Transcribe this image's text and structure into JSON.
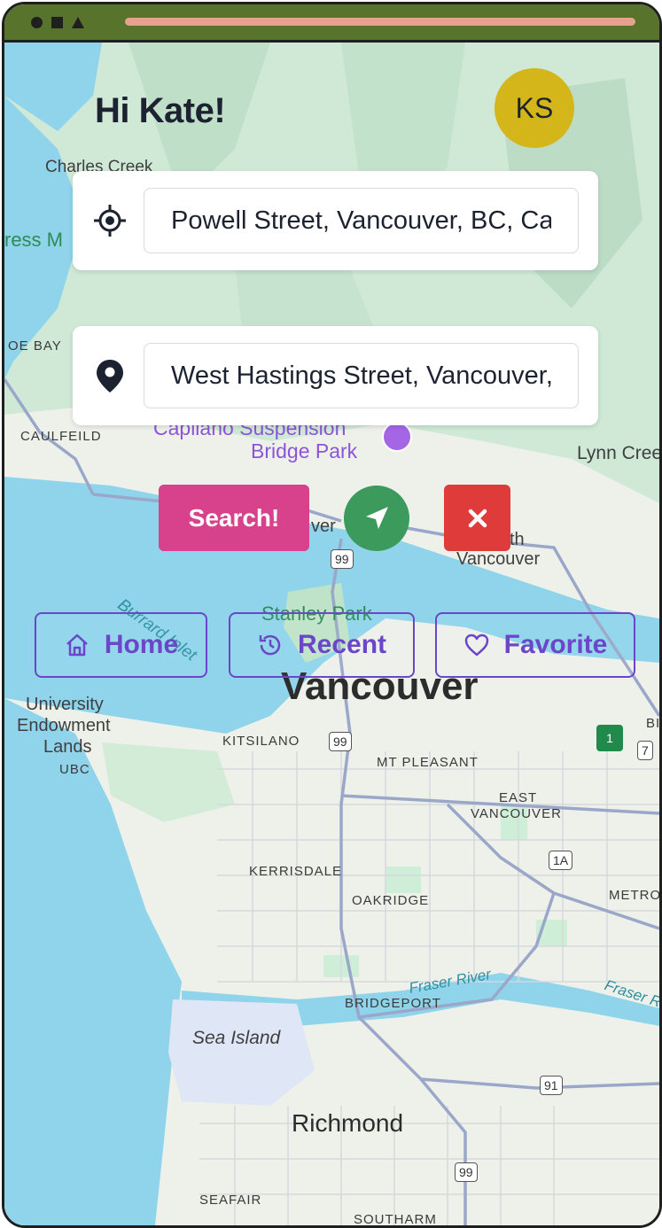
{
  "window": {
    "controls": [
      "circle",
      "square",
      "triangle"
    ]
  },
  "header": {
    "greeting": "Hi Kate!",
    "avatar_initials": "KS"
  },
  "origin": {
    "icon": "crosshair-icon",
    "value": "Powell Street, Vancouver, BC, Canada"
  },
  "destination": {
    "icon": "map-pin-icon",
    "value": "West Hastings Street, Vancouver, BC, Canada"
  },
  "actions": {
    "search_label": "Search!",
    "navigate_icon": "navigation-arrow-icon",
    "close_icon": "close-icon"
  },
  "shortcuts": [
    {
      "label": "Home",
      "icon": "home-icon"
    },
    {
      "label": "Recent",
      "icon": "history-icon"
    },
    {
      "label": "Favorite",
      "icon": "heart-icon"
    }
  ],
  "colors": {
    "topbar": "#58742c",
    "avatar": "#d4b61b",
    "search": "#d8418c",
    "navigate": "#3b9a5c",
    "close": "#e03b3b",
    "chip": "#6b46c8",
    "water": "#8fd4ea",
    "park": "#bfe3c8"
  },
  "map_labels": {
    "charles_creek": "Charles Creek",
    "cress": "ress M",
    "oe_bay": "OE BAY",
    "caulfeild": "CAULFEILD",
    "capilano": "Capilano Suspension",
    "bridge_park": "Bridge Park",
    "lynn_creek": "Lynn Cree",
    "ver": "ver",
    "north": "th",
    "north_vancouver": "Vancouver",
    "burrard_inlet": "Burrard Inlet",
    "stanley_park": "Stanley Park",
    "vancouver": "Vancouver",
    "university": "University",
    "endowment": "Endowment",
    "lands": "Lands",
    "ubc": "UBC",
    "kitsilano": "KITSILANO",
    "mt_pleasant": "MT PLEASANT",
    "east": "EAST",
    "east_vancouver": "VANCOUVER",
    "kerrisdale": "KERRISDALE",
    "oakridge": "OAKRIDGE",
    "metro": "METRO",
    "fraser_river": "Fraser River",
    "fraser_r": "Fraser R",
    "bridgeport": "BRIDGEPORT",
    "sea_island": "Sea Island",
    "richmond": "Richmond",
    "seafair": "SEAFAIR",
    "southarm": "SOUTHARM",
    "bi": "BI",
    "hwy_99_a": "99",
    "hwy_99_b": "99",
    "hwy_99_c": "99",
    "hwy_1a": "1A",
    "hwy_91": "91",
    "hwy_7": "7",
    "hwy_1": "1"
  }
}
